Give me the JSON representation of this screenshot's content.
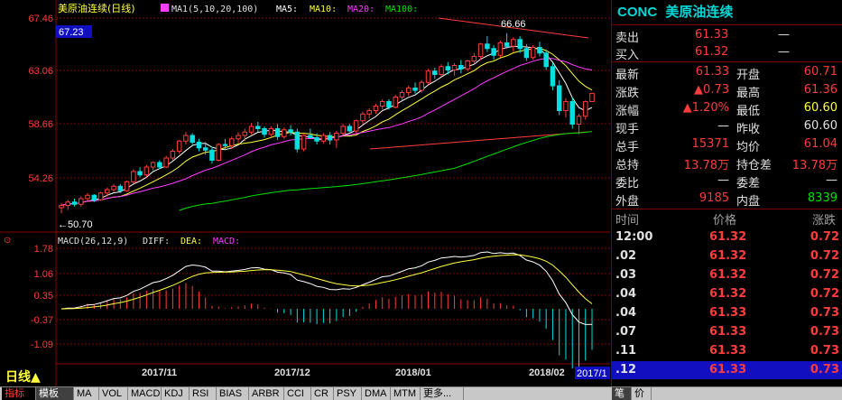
{
  "chart_header": {
    "title": "美原油连续(日线)",
    "ma_label": "MA1(5,10,20,100)",
    "ma5": "MA5:",
    "ma10": "MA10:",
    "ma20": "MA20:",
    "ma100": "MA100:",
    "current_price": "67.23",
    "high_label": "66.66",
    "low_label": "50.70"
  },
  "macd_header": {
    "label": "MACD(26,12,9)",
    "diff": "DIFF:",
    "dea": "DEA:",
    "macd": "MACD:"
  },
  "colors": {
    "up": "#ff3c3c",
    "down": "#00e0e0",
    "ma5": "#ffffff",
    "ma10": "#ffff3c",
    "ma20": "#ff3cff",
    "ma100": "#00e000",
    "grid": "#8a0000"
  },
  "chart_data": {
    "type": "candlestick",
    "price_axis": [
      "67.46",
      "63.06",
      "58.66",
      "54.26"
    ],
    "macd_axis": [
      "1.78",
      "1.06",
      "0.35",
      "-0.37",
      "-1.09"
    ],
    "x_ticks": [
      "2017/11",
      "2017/12",
      "2018/01",
      "2018/02"
    ],
    "x_tick_right": "2017/1",
    "ylim": [
      50.0,
      68.0
    ],
    "macd_ylim": [
      -1.5,
      1.9
    ],
    "candles": [
      [
        51.2,
        51.6,
        50.7,
        51.4
      ],
      [
        51.4,
        51.9,
        51.0,
        51.7
      ],
      [
        51.7,
        52.0,
        51.3,
        51.5
      ],
      [
        51.5,
        52.2,
        51.3,
        52.0
      ],
      [
        52.0,
        52.5,
        51.8,
        52.3
      ],
      [
        52.3,
        52.4,
        51.7,
        51.9
      ],
      [
        51.9,
        52.6,
        51.8,
        52.5
      ],
      [
        52.5,
        53.0,
        52.2,
        52.8
      ],
      [
        52.8,
        53.3,
        52.6,
        53.1
      ],
      [
        53.1,
        53.3,
        52.5,
        52.7
      ],
      [
        52.7,
        53.6,
        52.6,
        53.5
      ],
      [
        53.5,
        54.6,
        53.3,
        54.4
      ],
      [
        54.4,
        54.8,
        53.9,
        54.1
      ],
      [
        54.1,
        55.0,
        53.9,
        54.8
      ],
      [
        54.8,
        55.3,
        54.5,
        55.2
      ],
      [
        55.2,
        55.4,
        54.6,
        54.8
      ],
      [
        54.8,
        55.8,
        54.7,
        55.6
      ],
      [
        55.6,
        56.4,
        55.4,
        56.2
      ],
      [
        56.2,
        57.2,
        56.0,
        57.1
      ],
      [
        57.1,
        57.9,
        56.8,
        57.6
      ],
      [
        57.6,
        57.8,
        56.7,
        57.0
      ],
      [
        57.0,
        57.3,
        56.2,
        56.5
      ],
      [
        56.5,
        57.0,
        55.9,
        56.3
      ],
      [
        56.3,
        56.6,
        55.1,
        55.4
      ],
      [
        55.4,
        56.9,
        55.3,
        56.8
      ],
      [
        56.8,
        57.3,
        56.3,
        56.7
      ],
      [
        56.7,
        57.5,
        56.4,
        57.3
      ],
      [
        57.3,
        57.9,
        56.9,
        57.6
      ],
      [
        57.6,
        58.2,
        57.1,
        57.9
      ],
      [
        57.9,
        58.7,
        57.7,
        58.4
      ],
      [
        58.4,
        58.8,
        57.9,
        58.2
      ],
      [
        58.2,
        58.4,
        57.4,
        57.7
      ],
      [
        57.7,
        58.4,
        57.5,
        58.2
      ],
      [
        58.2,
        58.6,
        57.2,
        57.5
      ],
      [
        57.5,
        58.3,
        57.3,
        58.1
      ],
      [
        58.1,
        58.5,
        57.6,
        57.9
      ],
      [
        57.9,
        58.2,
        56.1,
        56.4
      ],
      [
        56.4,
        57.7,
        56.2,
        57.6
      ],
      [
        57.6,
        58.2,
        57.3,
        57.4
      ],
      [
        57.4,
        57.8,
        56.8,
        57.1
      ],
      [
        57.1,
        57.8,
        56.9,
        57.6
      ],
      [
        57.6,
        57.9,
        56.8,
        57.2
      ],
      [
        57.2,
        58.0,
        56.5,
        57.8
      ],
      [
        57.8,
        58.6,
        57.6,
        58.4
      ],
      [
        58.4,
        58.6,
        57.9,
        58.0
      ],
      [
        58.0,
        59.0,
        57.8,
        58.9
      ],
      [
        58.9,
        59.7,
        58.6,
        59.5
      ],
      [
        59.5,
        60.0,
        59.1,
        59.8
      ],
      [
        59.8,
        60.4,
        59.5,
        60.2
      ],
      [
        60.2,
        60.8,
        59.9,
        60.6
      ],
      [
        60.6,
        60.8,
        59.9,
        60.1
      ],
      [
        60.1,
        61.2,
        60.0,
        61.0
      ],
      [
        61.0,
        61.6,
        60.7,
        61.4
      ],
      [
        61.4,
        62.0,
        61.1,
        61.8
      ],
      [
        61.8,
        62.3,
        61.3,
        61.6
      ],
      [
        61.6,
        62.5,
        61.4,
        62.3
      ],
      [
        62.3,
        63.5,
        62.1,
        63.3
      ],
      [
        63.3,
        63.6,
        62.6,
        63.0
      ],
      [
        63.0,
        63.9,
        62.8,
        63.7
      ],
      [
        63.7,
        64.1,
        63.0,
        63.4
      ],
      [
        63.4,
        64.0,
        62.9,
        63.8
      ],
      [
        63.8,
        64.3,
        63.1,
        63.5
      ],
      [
        63.5,
        64.3,
        63.3,
        64.2
      ],
      [
        64.2,
        64.9,
        63.9,
        64.6
      ],
      [
        64.6,
        65.8,
        64.3,
        65.7
      ],
      [
        65.7,
        66.4,
        65.0,
        65.3
      ],
      [
        65.3,
        65.6,
        64.3,
        64.7
      ],
      [
        64.7,
        66.0,
        64.5,
        65.8
      ],
      [
        65.8,
        66.66,
        65.3,
        65.5
      ],
      [
        65.5,
        66.3,
        65.0,
        66.1
      ],
      [
        66.1,
        66.4,
        64.9,
        65.3
      ],
      [
        65.3,
        65.7,
        64.2,
        64.5
      ],
      [
        64.5,
        65.6,
        64.3,
        65.4
      ],
      [
        65.4,
        65.9,
        64.6,
        64.9
      ],
      [
        64.9,
        65.2,
        63.4,
        63.7
      ],
      [
        63.7,
        64.0,
        61.6,
        62.0
      ],
      [
        62.0,
        62.5,
        59.4,
        59.8
      ],
      [
        59.8,
        60.9,
        59.2,
        60.6
      ],
      [
        60.6,
        61.0,
        58.2,
        58.6
      ],
      [
        58.6,
        59.5,
        57.7,
        59.3
      ],
      [
        59.3,
        60.7,
        59.0,
        60.6
      ],
      [
        60.6,
        61.36,
        60.6,
        61.33
      ]
    ]
  },
  "side": {
    "code": "CONC",
    "name": "美原油连续",
    "sell_label": "卖出",
    "sell_value": "61.33",
    "sell_vol": "—",
    "buy_label": "买入",
    "buy_value": "61.32",
    "buy_vol": "—",
    "rows": [
      {
        "l1": "最新",
        "v1": "61.33",
        "c1": "red",
        "l2": "开盘",
        "v2": "60.71",
        "c2": "red"
      },
      {
        "l1": "涨跌",
        "v1": "▲0.73",
        "c1": "red",
        "l2": "最高",
        "v2": "61.36",
        "c2": "red"
      },
      {
        "l1": "涨幅",
        "v1": "▲1.20%",
        "c1": "red",
        "l2": "最低",
        "v2": "60.60",
        "c2": "yellow"
      },
      {
        "l1": "现手",
        "v1": "—",
        "c1": "white",
        "l2": "昨收",
        "v2": "60.60",
        "c2": "white"
      },
      {
        "l1": "总手",
        "v1": "15371",
        "c1": "red",
        "l2": "均价",
        "v2": "61.04",
        "c2": "red"
      },
      {
        "l1": "总持",
        "v1": "13.78万",
        "c1": "red",
        "l2": "持仓差",
        "v2": "13.78万",
        "c2": "red"
      },
      {
        "l1": "委比",
        "v1": "—",
        "c1": "white",
        "l2": "委差",
        "v2": "—",
        "c2": "white"
      },
      {
        "l1": "外盘",
        "v1": "9185",
        "c1": "red",
        "l2": "内盘",
        "v2": "8339",
        "c2": "green"
      }
    ],
    "tick_headers": {
      "time": "时间",
      "price": "价格",
      "change": "涨跌"
    },
    "ticks": [
      {
        "time": "12:00",
        "price": "61.32",
        "change": "0.72"
      },
      {
        "time": ".02",
        "price": "61.32",
        "change": "0.72"
      },
      {
        "time": ".03",
        "price": "61.32",
        "change": "0.72"
      },
      {
        "time": ".04",
        "price": "61.32",
        "change": "0.72"
      },
      {
        "time": ".04",
        "price": "61.33",
        "change": "0.73"
      },
      {
        "time": ".07",
        "price": "61.33",
        "change": "0.73"
      },
      {
        "time": ".11",
        "price": "61.33",
        "change": "0.73"
      },
      {
        "time": ".12",
        "price": "61.33",
        "change": "0.73"
      }
    ]
  },
  "bottom": {
    "dayline": "日线▲",
    "tabs": [
      "指标",
      "模板",
      "MA",
      "VOL",
      "MACD",
      "KDJ",
      "RSI",
      "BIAS",
      "ARBR",
      "CCI",
      "CR",
      "PSY",
      "DMA",
      "MTM",
      "更多..."
    ],
    "right_tabs": [
      "笔",
      "价"
    ]
  }
}
